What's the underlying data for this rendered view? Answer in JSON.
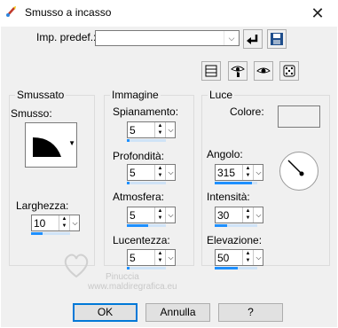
{
  "window": {
    "title": "Smusso a incasso",
    "close_glyph": "✕"
  },
  "preset": {
    "label": "Imp. predef.:",
    "value": ""
  },
  "groups": {
    "smussato": {
      "legend": "Smussato",
      "smusso_label": "Smusso:",
      "larghezza_label": "Larghezza:",
      "larghezza_value": "10",
      "larghezza_level": 0.3
    },
    "immagine": {
      "legend": "Immagine",
      "fields": [
        {
          "label": "Spianamento:",
          "value": "5",
          "level": 0.05
        },
        {
          "label": "Profondità:",
          "value": "5",
          "level": 0.05
        },
        {
          "label": "Atmosfera:",
          "value": "5",
          "level": 0.55
        },
        {
          "label": "Lucentezza:",
          "value": "5",
          "level": 0.05
        }
      ]
    },
    "luce": {
      "legend": "Luce",
      "colore_label": "Colore:",
      "colore_value": "#ffffff",
      "fields": [
        {
          "label": "Angolo:",
          "value": "315",
          "level": 0.88
        },
        {
          "label": "Intensità:",
          "value": "30",
          "level": 0.3
        },
        {
          "label": "Elevazione:",
          "value": "50",
          "level": 0.55
        }
      ]
    }
  },
  "watermark": {
    "line1": "Pinuccia",
    "line2": "www.maldiregrafica.eu"
  },
  "buttons": {
    "ok": "OK",
    "cancel": "Annulla",
    "help": "?"
  },
  "colors": {
    "accent": "#1e90ff",
    "ok_border": "#0078d7"
  }
}
